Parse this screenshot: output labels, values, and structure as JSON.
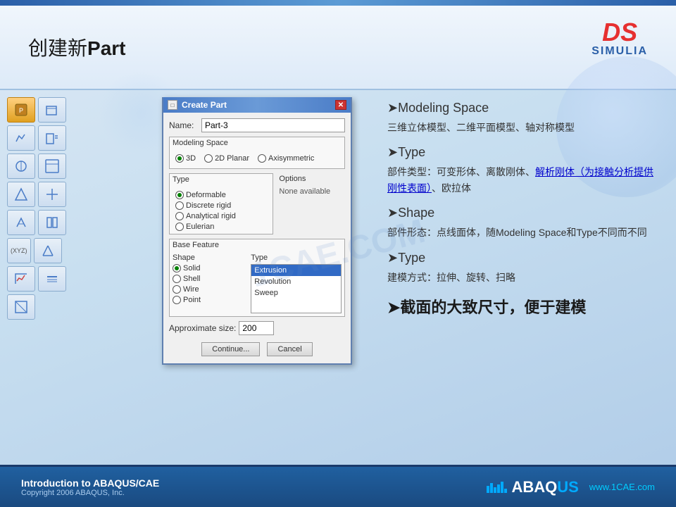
{
  "header": {
    "title_prefix": "创建新",
    "title_bold": "Part",
    "logo_ds": "DS",
    "logo_simulia": "SIMULIA"
  },
  "dialog": {
    "title": "Create Part",
    "name_label": "Name:",
    "name_value": "Part-3",
    "modeling_space_label": "Modeling Space",
    "options_3d": "3D",
    "options_2d": "2D Planar",
    "options_axisym": "Axisymmetric",
    "type_label": "Type",
    "options_label": "Options",
    "type_deformable": "Deformable",
    "type_discrete_rigid": "Discrete rigid",
    "type_analytical_rigid": "Analytical rigid",
    "type_eulerian": "Eulerian",
    "none_available": "None available",
    "base_feature_label": "Base Feature",
    "shape_label": "Shape",
    "type2_label": "Type",
    "shape_solid": "Solid",
    "shape_shell": "Shell",
    "shape_wire": "Wire",
    "shape_point": "Point",
    "type_extrusion": "Extrusion",
    "type_revolution": "Revolution",
    "type_sweep": "Sweep",
    "approx_label": "Approximate size:",
    "approx_value": "200",
    "btn_continue": "Continue...",
    "btn_cancel": "Cancel",
    "close_icon": "✕",
    "titlebar_icon": "□"
  },
  "content": {
    "section1_heading": "➤Modeling Space",
    "section1_text": "三维立体模型、二维平面模型、轴对称模型",
    "section2_heading": "➤Type",
    "section2_text_pre": "部件类型：可变形体、离散刚体、",
    "section2_link": "解析刚体（为接触分析提供刚性表面）",
    "section2_text_post": "、欧拉体",
    "section3_heading": "➤Shape",
    "section3_text": "部件形态：点线面体，随Modeling Space和Type不同而不同",
    "section4_heading": "➤Type",
    "section4_text": "建模方式：拉伸、旋转、扫略",
    "section5_text": "➤截面的大致尺寸，便于建模"
  },
  "footer": {
    "title": "Introduction to ABAQUS/CAE",
    "copyright": "Copyright 2006 ABAQUS, Inc.",
    "brand_ab": "ABAQ",
    "brand_us": "US",
    "url": "www.1CAE.com"
  },
  "watermark": "1CAE.COM"
}
